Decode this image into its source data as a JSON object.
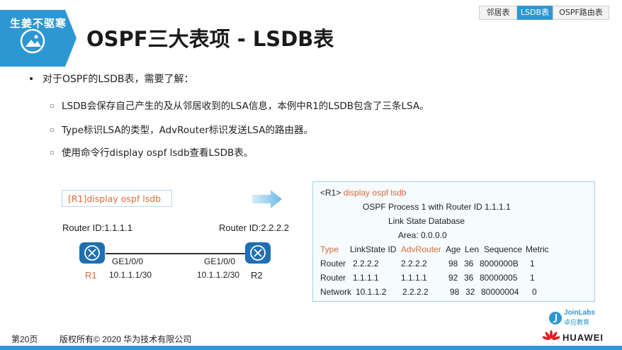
{
  "header": {
    "logo_text": "生姜不驱寒",
    "title": "OSPF三大表项 - LSDB表",
    "nav": [
      "邻居表",
      "LSDB表",
      "OSPF路由表"
    ]
  },
  "bullets": {
    "main": "对于OSPF的LSDB表，需要了解：",
    "subs": [
      "LSDB会保存自己产生的及从邻居收到的LSA信息，本例中R1的LSDB包含了三条LSA。",
      "Type标识LSA的类型，AdvRouter标识发送LSA的路由器。",
      "使用命令行display ospf lsdb查看LSDB表。"
    ]
  },
  "diagram": {
    "command": "[R1]display ospf lsdb",
    "r1_id": "Router ID:1.1.1.1",
    "r2_id": "Router ID:2.2.2.2",
    "r1_if": "GE1/0/0",
    "r2_if": "GE1/0/0",
    "r1_name": "R1",
    "r2_name": "R2",
    "r1_ip": "10.1.1.1/30",
    "r2_ip": "10.1.1.2/30"
  },
  "output": {
    "prompt": "<R1>",
    "command": "display ospf lsdb",
    "line1": "OSPF Process 1 with Router ID 1.1.1.1",
    "line2": "Link State Database",
    "line3": "Area: 0.0.0.0",
    "headers": [
      "Type",
      "LinkState ID",
      "AdvRouter",
      "Age",
      "Len",
      "Sequence",
      "Metric"
    ],
    "rows": [
      [
        "Router",
        "2.2.2.2",
        "2.2.2.2",
        "98",
        "36",
        "8000000B",
        "1"
      ],
      [
        "Router",
        "1.1.1.1",
        "1.1.1.1",
        "92",
        "36",
        "80000005",
        "1"
      ],
      [
        "Network",
        "10.1.1.2",
        "2.2.2.2",
        "98",
        "32",
        "80000004",
        "0"
      ]
    ]
  },
  "footer": {
    "page": "第20页",
    "copyright": "版权所有© 2020 华为技术有限公司",
    "joinlabs": "JoinLabs",
    "joinlabs_cn": "卓应教育",
    "huawei": "HUAWEI"
  },
  "colors": {
    "accent": "#2c97d3",
    "orange": "#e06a3b",
    "huawei_red": "#e02020"
  }
}
